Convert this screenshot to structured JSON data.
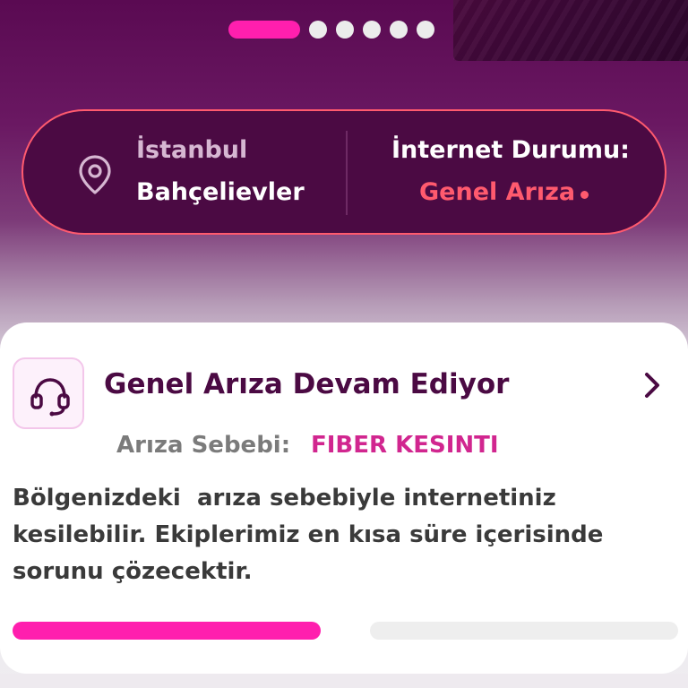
{
  "carousel": {
    "slides": [
      "active",
      "dot",
      "dot",
      "dot",
      "dot",
      "dot",
      "dot"
    ]
  },
  "location": {
    "icon": "location-pin-icon",
    "city": "İstanbul",
    "district": "Bahçelievler"
  },
  "internet": {
    "label": "İnternet Durumu:",
    "status": "Genel Arıza",
    "status_color": "#ff5a6e"
  },
  "alert": {
    "icon": "headset-icon",
    "title": "Genel Arıza Devam Ediyor",
    "chevron_icon": "chevron-right-icon",
    "cause_label": "Arıza Sebebi:",
    "cause_value": "FIBER KESINTI",
    "description": "Bölgenizdeki  arıza sebebiyle internetiniz\nkesilebilir. Ekiplerimiz en kısa süre içerisinde\nsorunu çözecektir."
  },
  "colors": {
    "accent": "#ff1fae",
    "brand_dark": "#4b0a43",
    "cause": "#d1268f"
  },
  "progress": {
    "segments": [
      1,
      0
    ]
  }
}
